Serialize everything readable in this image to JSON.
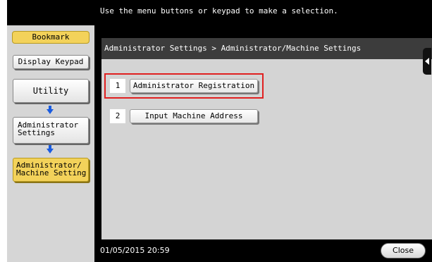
{
  "header": {
    "message": "Use the menu buttons or keypad to make a selection."
  },
  "sidebar": {
    "bookmark_label": "Bookmark",
    "display_keypad_label": "Display Keypad",
    "utility_label": "Utility",
    "admin_settings_line1": "Administrator",
    "admin_settings_line2": "Settings",
    "machine_setting_line1": "Administrator/",
    "machine_setting_line2": "Machine Setting"
  },
  "panel": {
    "breadcrumb": "Administrator Settings > Administrator/Machine Settings",
    "items": [
      {
        "number": "1",
        "label": "Administrator Registration"
      },
      {
        "number": "2",
        "label": "Input Machine Address"
      }
    ]
  },
  "status": {
    "datetime": "01/05/2015  20:59",
    "close_label": "Close"
  },
  "colors": {
    "accent_yellow": "#f3d25a",
    "highlight_red": "#e02020",
    "arrow_blue": "#1a5ce0"
  },
  "icons": [
    "down-arrow-icon",
    "panel-collapse-icon"
  ]
}
